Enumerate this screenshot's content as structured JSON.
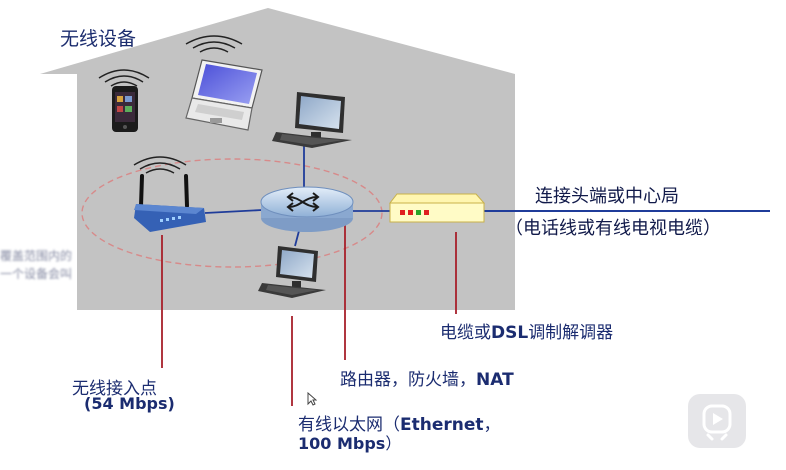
{
  "house_title": "无线设备",
  "headend": {
    "line1": "连接头端或中心局",
    "line2": "（电话线或有线电视电缆）"
  },
  "modem_label": {
    "pre": "电缆或",
    "bold": "DSL",
    "post": "调制解调器"
  },
  "router_label": {
    "pre": "路由器，防火墙，",
    "bold": "NAT"
  },
  "ap_label": {
    "line1": "无线接入点",
    "line2": "(54 Mbps)"
  },
  "ethernet_label": {
    "line1_pre": "有线以太网（",
    "line1_bold": "Ethernet",
    "line1_post": "，",
    "line2": "100 Mbps",
    "line2_post": "）"
  },
  "blurred_annotation": {
    "line1": "覆盖范围内的",
    "line2": "一个设备会叫"
  },
  "colors": {
    "house": "#c3c3c3",
    "label_text": "#1f2f7a",
    "callout_line": "#a8202a",
    "network_line": "#1f3c9a",
    "router": "#b9cde6",
    "modem": "#fffbc6",
    "range_ellipse": "#d78a8a"
  }
}
